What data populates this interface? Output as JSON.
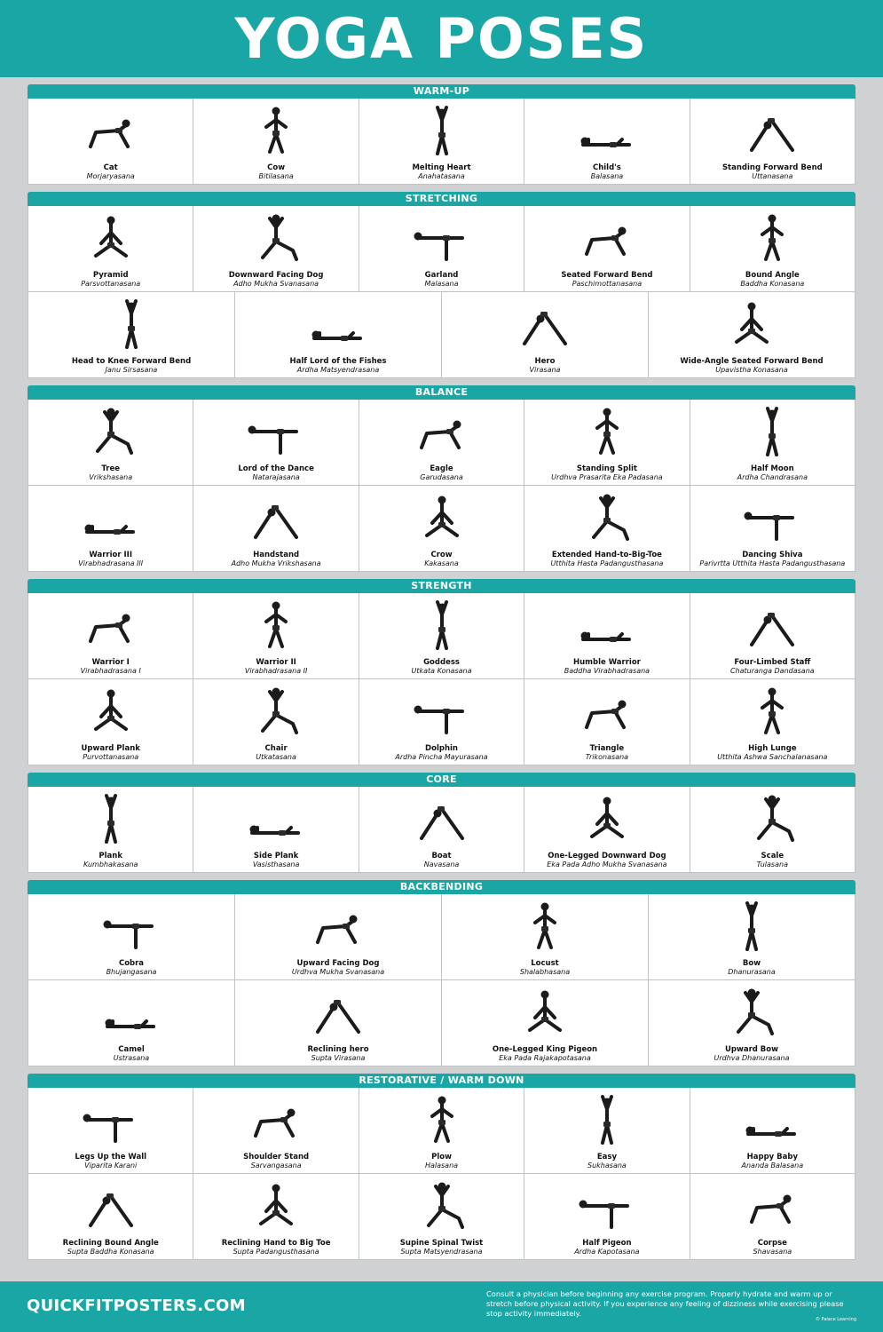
{
  "title": "YOGA POSES",
  "footer": {
    "brand": "QUICKFITPOSTERS.COM",
    "disclaimer": "Consult a physician before beginning any exercise program. Properly hydrate and warm up or stretch before physical activity. If you experience any feeling of dizziness while exercising please stop activity immediately.",
    "copyright": "© Palace Learning"
  },
  "colors": {
    "accent": "#1aa6a4",
    "background": "#cfd1d2",
    "cell": "#ffffff"
  },
  "sections": [
    {
      "title": "WARM-UP",
      "rows": [
        [
          [
            "Cat",
            "Morjaryasana"
          ],
          [
            "Cow",
            "Bitilasana"
          ],
          [
            "Melting Heart",
            "Anahatasana"
          ],
          [
            "Child's",
            "Balasana"
          ],
          [
            "Standing Forward Bend",
            "Uttanasana"
          ]
        ]
      ]
    },
    {
      "title": "STRETCHING",
      "rows": [
        [
          [
            "Pyramid",
            "Parsvottanasana"
          ],
          [
            "Downward Facing Dog",
            "Adho Mukha Svanasana"
          ],
          [
            "Garland",
            "Malasana"
          ],
          [
            "Seated Forward Bend",
            "Paschimottanasana"
          ],
          [
            "Bound Angle",
            "Baddha Konasana"
          ]
        ],
        [
          [
            "Head to Knee Forward Bend",
            "Janu Sirsasana"
          ],
          [
            "Half Lord of the Fishes",
            "Ardha Matsyendrasana"
          ],
          [
            "Hero",
            "Virasana"
          ],
          [
            "Wide-Angle Seated Forward Bend",
            "Upavistha Konasana"
          ]
        ]
      ]
    },
    {
      "title": "BALANCE",
      "rows": [
        [
          [
            "Tree",
            "Vrikshasana"
          ],
          [
            "Lord of the Dance",
            "Natarajasana"
          ],
          [
            "Eagle",
            "Garudasana"
          ],
          [
            "Standing Split",
            "Urdhva Prasarita Eka Padasana"
          ],
          [
            "Half Moon",
            "Ardha Chandrasana"
          ]
        ],
        [
          [
            "Warrior III",
            "Virabhadrasana III"
          ],
          [
            "Handstand",
            "Adho Mukha Vrikshasana"
          ],
          [
            "Crow",
            "Kakasana"
          ],
          [
            "Extended Hand-to-Big-Toe",
            "Utthita Hasta Padangusthasana"
          ],
          [
            "Dancing Shiva",
            "Parivrtta Utthita Hasta Padangusthasana"
          ]
        ]
      ]
    },
    {
      "title": "STRENGTH",
      "rows": [
        [
          [
            "Warrior I",
            "Virabhadrasana I"
          ],
          [
            "Warrior II",
            "Virabhadrasana II"
          ],
          [
            "Goddess",
            "Utkata Konasana"
          ],
          [
            "Humble Warrior",
            "Baddha Virabhadrasana"
          ],
          [
            "Four-Limbed Staff",
            "Chaturanga Dandasana"
          ]
        ],
        [
          [
            "Upward Plank",
            "Purvottanasana"
          ],
          [
            "Chair",
            "Utkatasana"
          ],
          [
            "Dolphin",
            "Ardha Pincha Mayurasana"
          ],
          [
            "Triangle",
            "Trikonasana"
          ],
          [
            "High Lunge",
            "Utthita Ashwa Sanchalanasana"
          ]
        ]
      ]
    },
    {
      "title": "CORE",
      "rows": [
        [
          [
            "Plank",
            "Kumbhakasana"
          ],
          [
            "Side Plank",
            "Vasisthasana"
          ],
          [
            "Boat",
            "Navasana"
          ],
          [
            "One-Legged Downward Dog",
            "Eka Pada Adho Mukha Svanasana"
          ],
          [
            "Scale",
            "Tulasana"
          ]
        ]
      ]
    },
    {
      "title": "BACKBENDING",
      "rows": [
        [
          [
            "Cobra",
            "Bhujangasana"
          ],
          [
            "Upward Facing Dog",
            "Urdhva Mukha Svanasana"
          ],
          [
            "Locust",
            "Shalabhasana"
          ],
          [
            "Bow",
            "Dhanurasana"
          ]
        ],
        [
          [
            "Camel",
            "Ustrasana"
          ],
          [
            "Reclining hero",
            "Supta Virasana"
          ],
          [
            "One-Legged King Pigeon",
            "Eka Pada Rajakapotasana"
          ],
          [
            "Upward Bow",
            "Urdhva Dhanurasana"
          ]
        ]
      ]
    },
    {
      "title": "RESTORATIVE / WARM DOWN",
      "rows": [
        [
          [
            "Legs Up the Wall",
            "Viparita Karani"
          ],
          [
            "Shoulder Stand",
            "Sarvangasana"
          ],
          [
            "Plow",
            "Halasana"
          ],
          [
            "Easy",
            "Sukhasana"
          ],
          [
            "Happy Baby",
            "Ananda Balasana"
          ]
        ],
        [
          [
            "Reclining Bound Angle",
            "Supta Baddha Konasana"
          ],
          [
            "Reclining Hand to Big Toe",
            "Supta Padangusthasana"
          ],
          [
            "Supine Spinal Twist",
            "Supta Matsyendrasana"
          ],
          [
            "Half Pigeon",
            "Ardha Kapotasana"
          ],
          [
            "Corpse",
            "Shavasana"
          ]
        ]
      ]
    }
  ]
}
